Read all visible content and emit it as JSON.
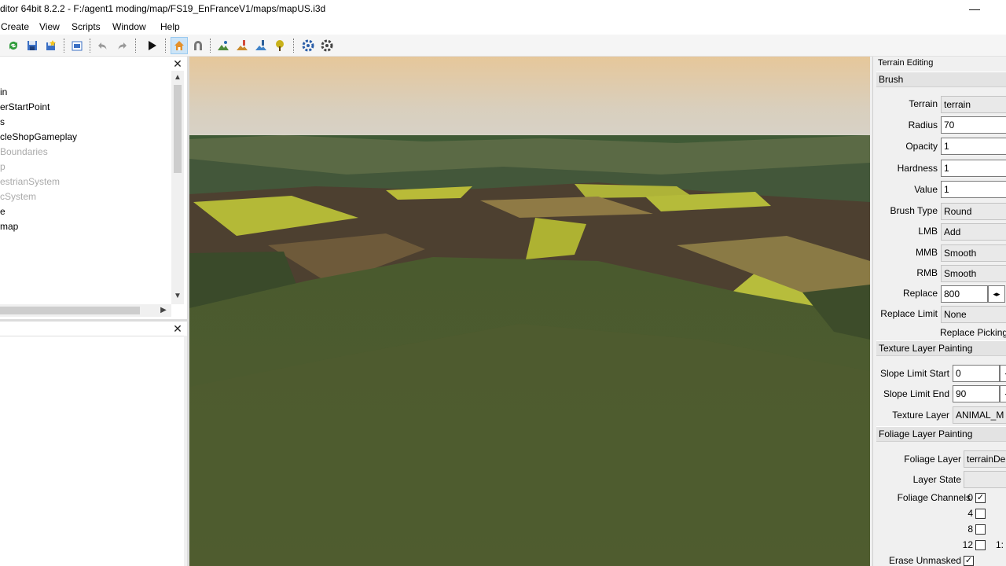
{
  "window": {
    "title": "ditor 64bit 8.2.2 - F:/agent1 moding/map/FS19_EnFranceV1/maps/mapUS.i3d",
    "minimize_glyph": "—"
  },
  "menu": {
    "items": [
      "Create",
      "View",
      "Scripts",
      "Window",
      "Help"
    ]
  },
  "toolbar": {
    "icons": [
      "refresh-icon",
      "save-icon",
      "save-all-icon",
      "export-icon",
      "undo-icon",
      "redo-icon",
      "play-icon",
      "select-tool-icon",
      "magnet-icon",
      "terrain-sculpt-icon",
      "terrain-paint-icon",
      "foliage-paint-icon",
      "tree-plant-icon",
      "settings-sync-icon",
      "settings-icon"
    ],
    "active": "select-tool-icon"
  },
  "scenegraph": {
    "items": [
      {
        "label": "in",
        "dim": false
      },
      {
        "label": "erStartPoint",
        "dim": false
      },
      {
        "label": "s",
        "dim": false
      },
      {
        "label": "cleShopGameplay",
        "dim": false
      },
      {
        "label": "Boundaries",
        "dim": true
      },
      {
        "label": "p",
        "dim": true
      },
      {
        "label": "estrianSystem",
        "dim": true
      },
      {
        "label": "cSystem",
        "dim": true
      },
      {
        "label": "e",
        "dim": false
      },
      {
        "label": "map",
        "dim": false
      }
    ]
  },
  "terrain_editing": {
    "panel_title": "Terrain Editing",
    "brush": {
      "header": "Brush",
      "terrain_label": "Terrain",
      "terrain_value": "terrain",
      "radius_label": "Radius",
      "radius_value": "70",
      "opacity_label": "Opacity",
      "opacity_value": "1",
      "hardness_label": "Hardness",
      "hardness_value": "1",
      "value_label": "Value",
      "value_value": "1",
      "brush_type_label": "Brush Type",
      "brush_type_value": "Round",
      "lmb_label": "LMB",
      "lmb_value": "Add",
      "mmb_label": "MMB",
      "mmb_value": "Smooth",
      "rmb_label": "RMB",
      "rmb_value": "Smooth",
      "replace_label": "Replace",
      "replace_value": "800",
      "replace_spin": "◂▸",
      "replace_limit_label": "Replace Limit",
      "replace_limit_value": "None",
      "replace_picking": "Replace Picking"
    },
    "texture": {
      "header": "Texture Layer Painting",
      "slope_start_label": "Slope Limit Start",
      "slope_start_value": "0",
      "slope_end_label": "Slope Limit End",
      "slope_end_value": "90",
      "texture_layer_label": "Texture Layer",
      "texture_layer_value": "ANIMAL_M"
    },
    "foliage": {
      "header": "Foliage Layer Painting",
      "foliage_layer_label": "Foliage Layer",
      "foliage_layer_value": "terrainDe",
      "layer_state_label": "Layer State",
      "layer_state_value": "",
      "channels_label": "Foliage Channels",
      "channels": [
        {
          "num": "0",
          "checked": true
        },
        {
          "num": "4",
          "checked": false
        },
        {
          "num": "8",
          "checked": false
        },
        {
          "num": "12",
          "checked": false
        }
      ],
      "channel_overflow": "1:",
      "erase_unmasked_label": "Erase Unmasked",
      "erase_unmasked_checked": true
    }
  }
}
